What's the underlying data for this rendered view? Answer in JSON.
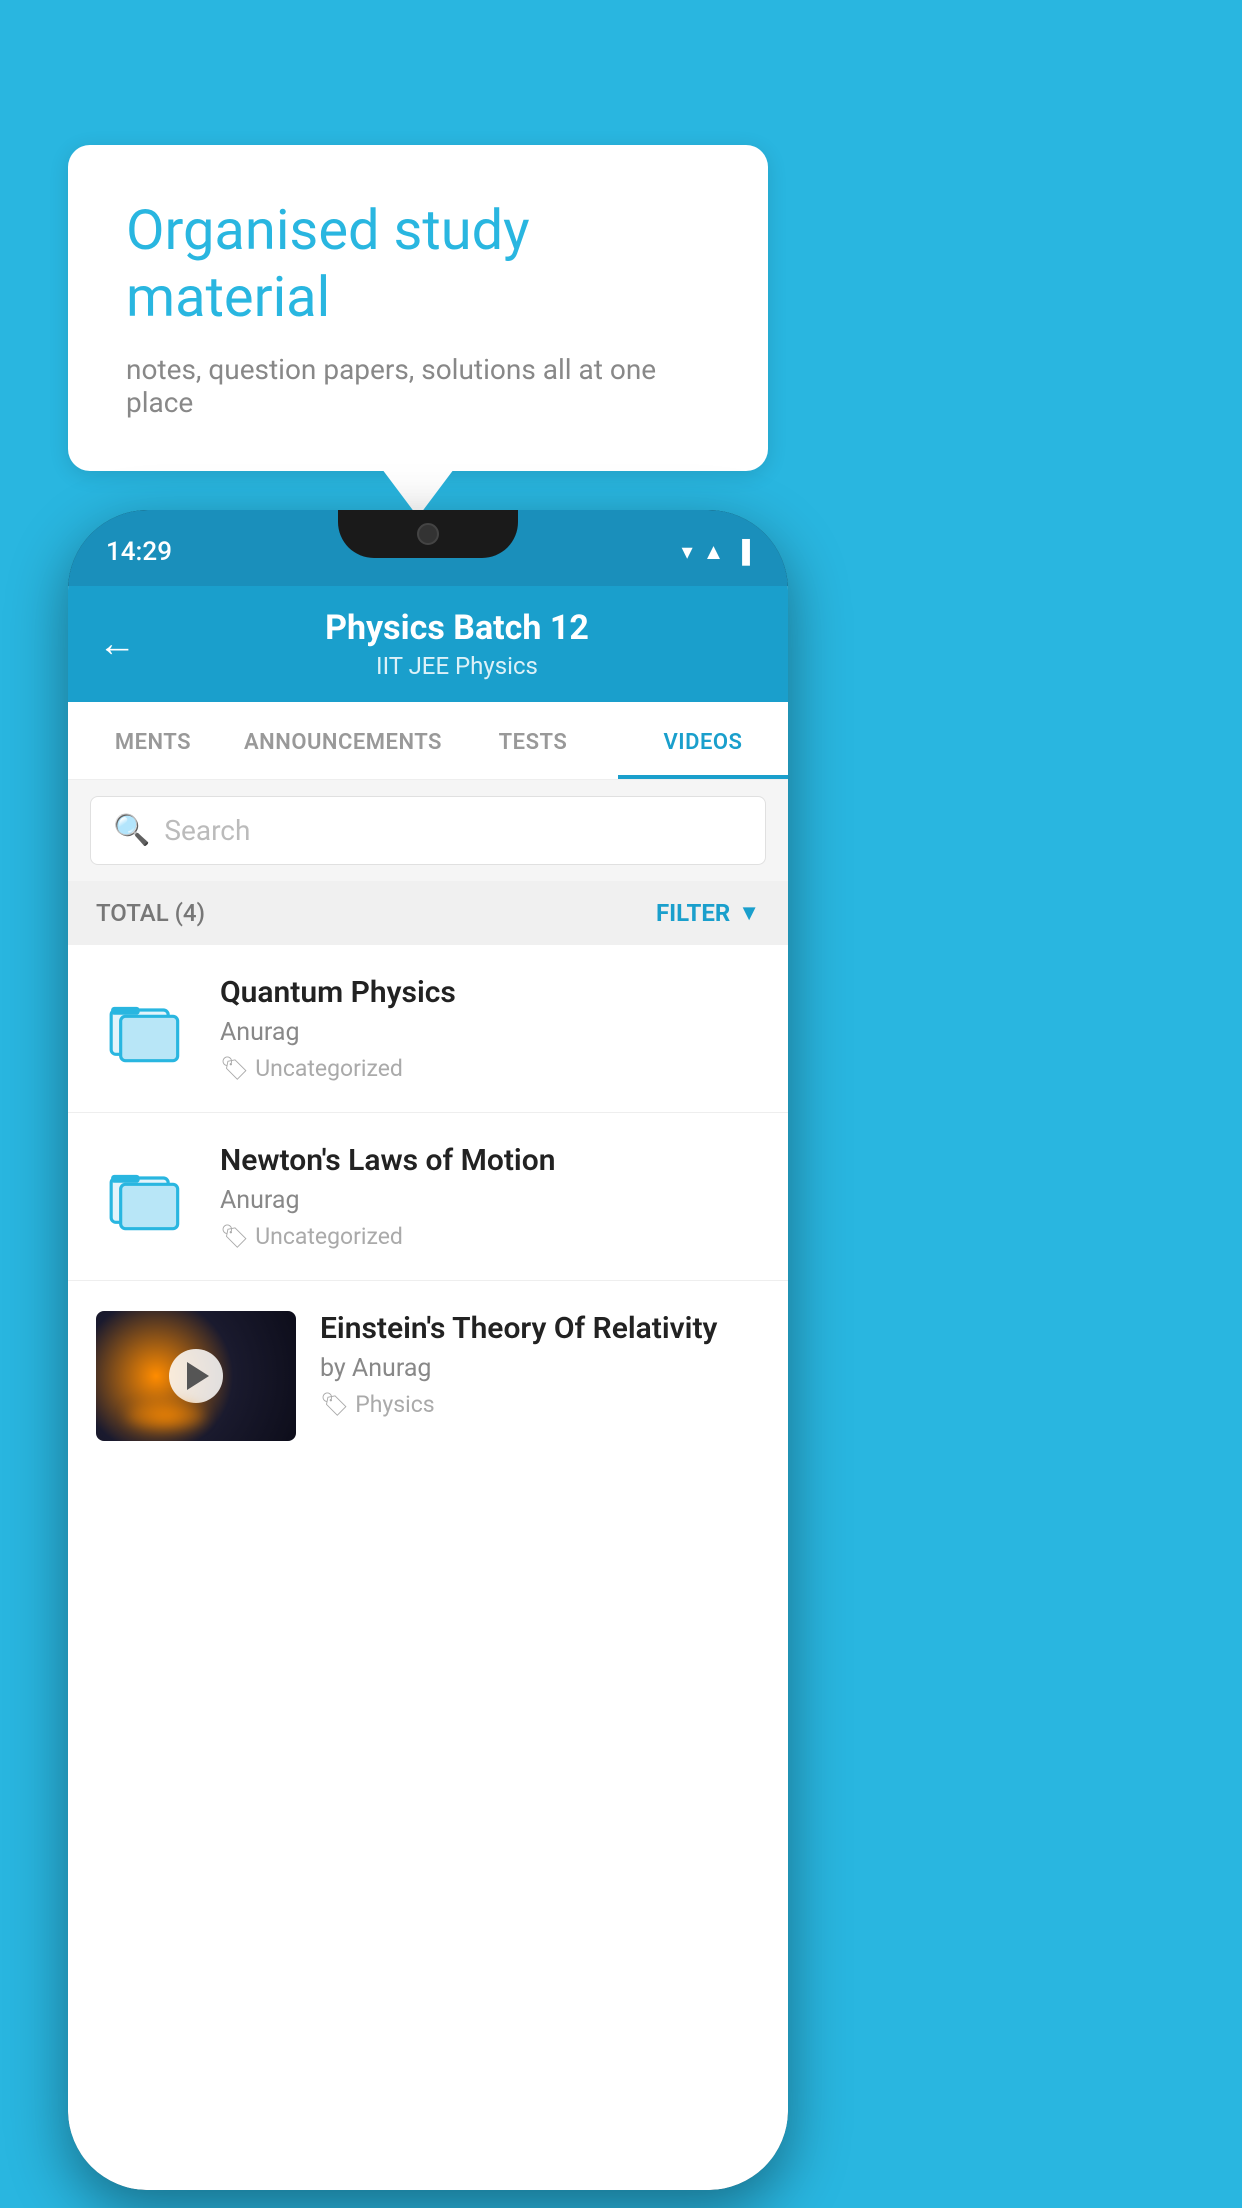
{
  "background_color": "#29b6e0",
  "speech_bubble": {
    "title": "Organised study material",
    "subtitle": "notes, question papers, solutions all at one place"
  },
  "phone": {
    "status_bar": {
      "time": "14:29",
      "icons": [
        "wifi",
        "signal",
        "battery"
      ]
    },
    "header": {
      "title": "Physics Batch 12",
      "subtitle": "IIT JEE   Physics",
      "back_label": "←"
    },
    "tabs": [
      {
        "label": "MENTS",
        "active": false
      },
      {
        "label": "ANNOUNCEMENTS",
        "active": false
      },
      {
        "label": "TESTS",
        "active": false
      },
      {
        "label": "VIDEOS",
        "active": true
      }
    ],
    "search": {
      "placeholder": "Search"
    },
    "total_bar": {
      "label": "TOTAL (4)",
      "filter_label": "FILTER"
    },
    "videos": [
      {
        "title": "Quantum Physics",
        "author": "Anurag",
        "tag": "Uncategorized",
        "has_thumbnail": false
      },
      {
        "title": "Newton's Laws of Motion",
        "author": "Anurag",
        "tag": "Uncategorized",
        "has_thumbnail": false
      },
      {
        "title": "Einstein's Theory Of Relativity",
        "author": "by Anurag",
        "tag": "Physics",
        "has_thumbnail": true
      }
    ]
  }
}
